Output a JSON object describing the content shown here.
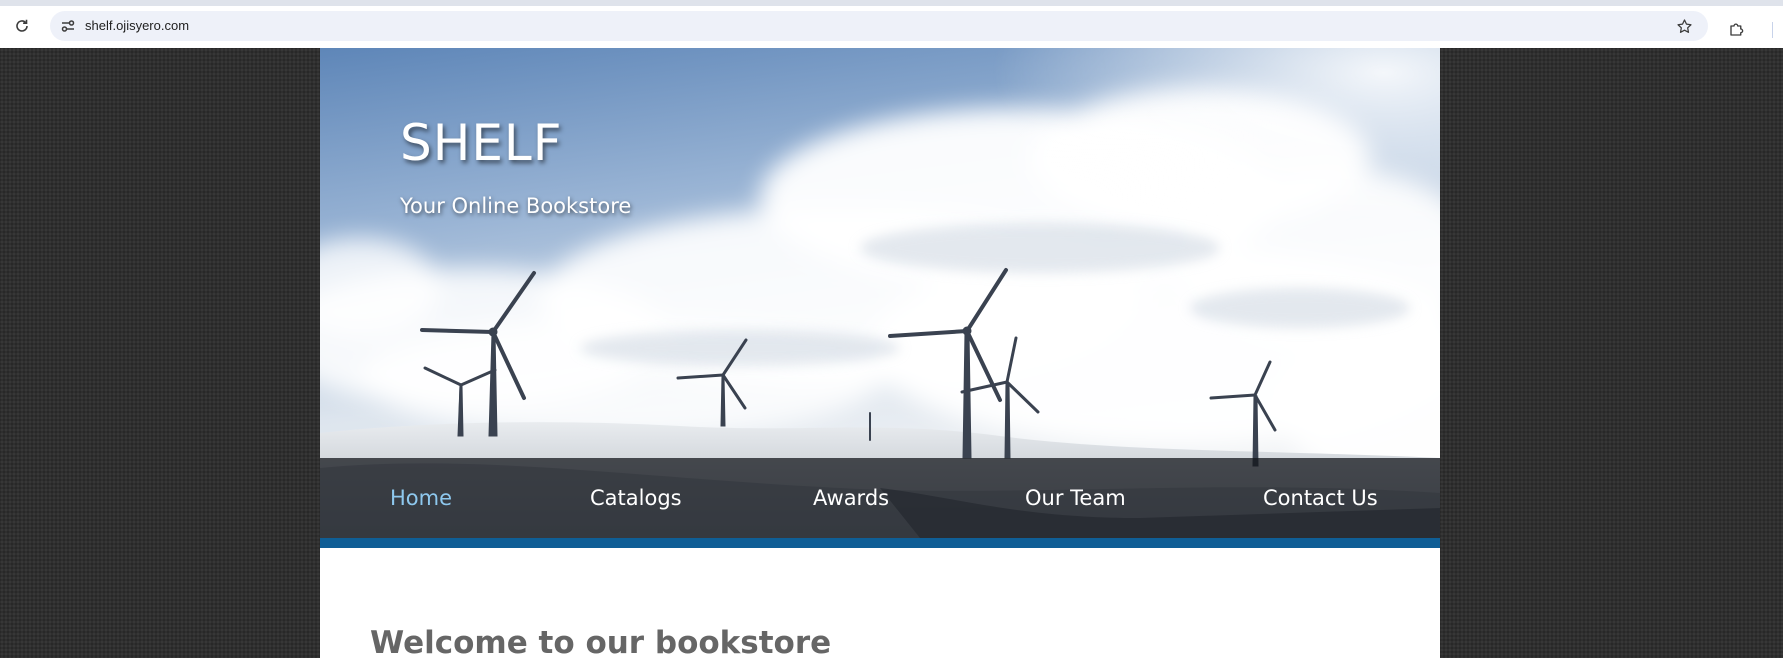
{
  "browser": {
    "url": "shelf.ojisyero.com",
    "icons": [
      "reload-icon",
      "site-info-icon",
      "star-icon",
      "extensions-icon"
    ]
  },
  "site": {
    "title": "SHELF",
    "tagline": "Your Online Bookstore"
  },
  "nav": {
    "items": [
      {
        "label": "Home",
        "active": true
      },
      {
        "label": "Catalogs",
        "active": false
      },
      {
        "label": "Awards",
        "active": false
      },
      {
        "label": "Our Team",
        "active": false
      },
      {
        "label": "Contact Us",
        "active": false
      }
    ]
  },
  "main": {
    "heading": "Welcome to our bookstore"
  },
  "colors": {
    "accent": "#0f5e96",
    "nav_active": "#8ec8ee",
    "page_background": "#2f2f2f",
    "heading_text": "#666666"
  }
}
